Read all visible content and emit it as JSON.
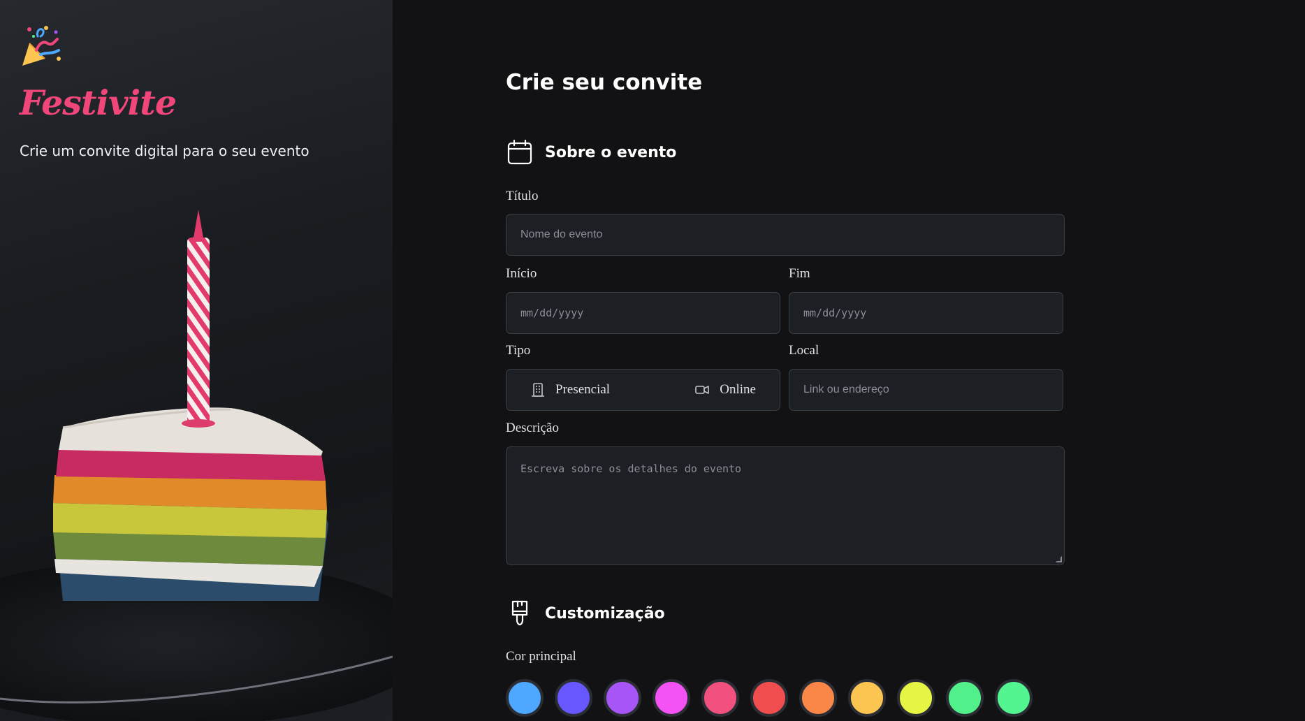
{
  "hero": {
    "brand": "Festivite",
    "tagline": "Crie um convite digital para o seu evento"
  },
  "form": {
    "title": "Crie seu convite",
    "about_section": {
      "title": "Sobre o evento",
      "icon": "calendar-icon",
      "title_label": "Título",
      "title_placeholder": "Nome do evento",
      "start_label": "Início",
      "start_placeholder": "mm/dd/yyyy",
      "end_label": "Fim",
      "end_placeholder": "mm/dd/yyyy",
      "type_label": "Tipo",
      "type_options": [
        {
          "label": "Presencial",
          "icon": "building-icon"
        },
        {
          "label": "Online",
          "icon": "video-camera-icon"
        }
      ],
      "location_label": "Local",
      "location_placeholder": "Link ou endereço",
      "description_label": "Descrição",
      "description_placeholder": "Escreva sobre os detalhes do evento"
    },
    "customization_section": {
      "title": "Customização",
      "icon": "paintbrush-icon",
      "main_color_label": "Cor principal",
      "colors": [
        "#4fa8ff",
        "#6657ff",
        "#a855f7",
        "#f552f5",
        "#f2507e",
        "#f04e4e",
        "#fa8748",
        "#fcc552",
        "#e6f543",
        "#52f08a",
        "#52f58f"
      ]
    }
  }
}
